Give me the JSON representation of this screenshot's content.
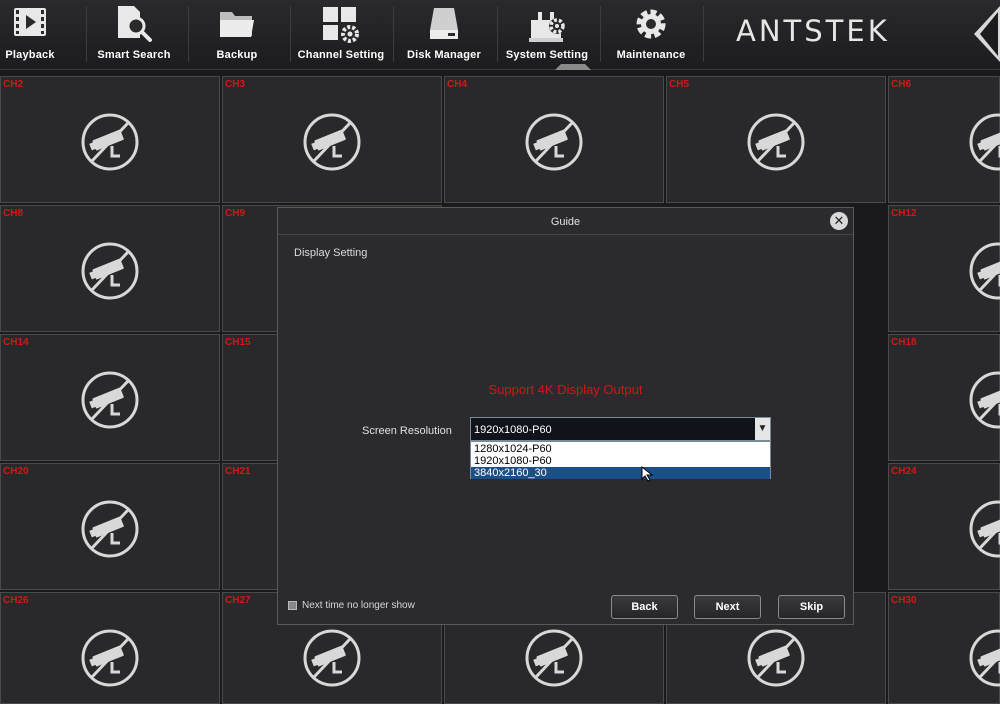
{
  "toolbar": {
    "items": [
      {
        "label": "Playback",
        "icon": "playback-film-icon"
      },
      {
        "label": "Smart Search",
        "icon": "smart-search-icon"
      },
      {
        "label": "Backup",
        "icon": "folder-icon"
      },
      {
        "label": "Channel Setting",
        "icon": "channel-setting-icon"
      },
      {
        "label": "Disk Manager",
        "icon": "disk-icon"
      },
      {
        "label": "System Setting",
        "icon": "system-setting-icon"
      },
      {
        "label": "Maintenance",
        "icon": "gear-icon"
      }
    ],
    "logo": "ANTSTEK"
  },
  "channels": {
    "row1": [
      "CH2",
      "CH3",
      "CH4",
      "CH5",
      "CH6"
    ],
    "row2": [
      "CH8",
      "CH9",
      "CH12"
    ],
    "row3": [
      "CH14",
      "CH15",
      "CH18"
    ],
    "row4": [
      "CH20",
      "CH21",
      "CH24"
    ],
    "row5": [
      "CH26",
      "CH27",
      "CH30"
    ],
    "no_video_icon": "no-camera-icon",
    "label_color": "#d01818"
  },
  "dialog": {
    "title": "Guide",
    "close_icon": "close-icon",
    "section": "Display Setting",
    "notice": "Support 4K Display Output",
    "resolution_label": "Screen Resolution",
    "resolution_value": "1920x1080-P60",
    "options": [
      "1280x1024-P60",
      "1920x1080-P60",
      "3840x2160_30"
    ],
    "highlighted_option": "3840x2160_30",
    "checkbox_label": "Next time no longer show",
    "checkbox_checked": false,
    "buttons": {
      "back": "Back",
      "next": "Next",
      "skip": "Skip"
    }
  },
  "colors": {
    "notice": "#d81414",
    "highlight": "#1b4f88",
    "channel_label": "#d01818"
  }
}
